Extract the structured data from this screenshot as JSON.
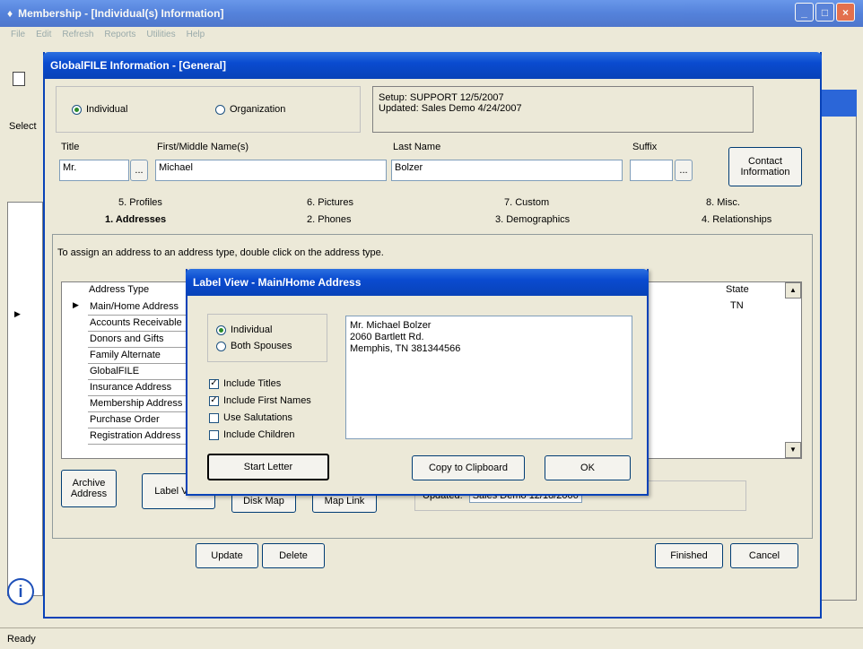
{
  "main_window": {
    "title": "Membership - [Individual(s) Information]",
    "menu": [
      "File",
      "Edit",
      "Refresh",
      "Reports",
      "Utilities",
      "Help"
    ],
    "select_label": "Select"
  },
  "dialog": {
    "title": "GlobalFILE Information - [General]",
    "type_options": {
      "individual": "Individual",
      "organization": "Organization",
      "selected": "Individual"
    },
    "setup_text": "Setup: SUPPORT 12/5/2007",
    "updated_text": "Updated: Sales Demo 4/24/2007",
    "labels": {
      "title": "Title",
      "first_name": "First/Middle Name(s)",
      "last_name": "Last Name",
      "suffix": "Suffix"
    },
    "values": {
      "title": "Mr.",
      "first_name": "Michael",
      "last_name": "Bolzer",
      "suffix": ""
    },
    "contact_button": "Contact Information",
    "tabs_row1": [
      "5. Profiles",
      "6. Pictures",
      "7. Custom",
      "8. Misc."
    ],
    "tabs_row2": [
      "1. Addresses",
      "2. Phones",
      "3. Demographics",
      "4. Relationships"
    ],
    "active_tab": "1. Addresses",
    "instructions": "To assign an address to an address type, double click on the address type.",
    "grid": {
      "header_address_type": "Address Type",
      "header_state": "State",
      "rows": [
        "Main/Home Address",
        "Accounts Receivable",
        "Donors and Gifts",
        "Family Alternate",
        "GlobalFILE",
        "Insurance Address",
        "Membership Address",
        "Purchase Order",
        "Registration Address"
      ],
      "first_row_state": "TN"
    },
    "archive_button": "Archive Address",
    "label_view_button": "Label View",
    "disk_map_button": "Disk Map",
    "map_link_button": "Map Link",
    "updated_label": "Updated:",
    "updated_value": "Sales Demo 12/18/2006",
    "update_button": "Update",
    "delete_button": "Delete",
    "finished_button": "Finished",
    "cancel_button": "Cancel"
  },
  "label_view": {
    "title": "Label View - Main/Home Address",
    "individual": "Individual",
    "both_spouses": "Both Spouses",
    "include_titles": "Include Titles",
    "include_first_names": "Include First Names",
    "use_salutations": "Use Salutations",
    "include_children": "Include Children",
    "address_text": "Mr. Michael Bolzer\n2060 Bartlett Rd.\nMemphis, TN 381344566",
    "start_letter": "Start Letter",
    "copy_clipboard": "Copy to Clipboard",
    "ok": "OK",
    "checks": {
      "include_titles": true,
      "include_first_names": true,
      "use_salutations": false,
      "include_children": false
    }
  },
  "status_bar": {
    "text": "Ready"
  },
  "colors": {
    "title_blue": "#0a4bd0",
    "close_red": "#e0481f",
    "panel": "#ece9d8"
  }
}
